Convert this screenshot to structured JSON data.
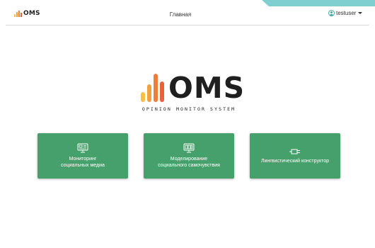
{
  "colors": {
    "accent_green": "#46a06b",
    "teal": "#7fcfd0",
    "logo_bars": [
      "#f6c048",
      "#f3a13f",
      "#ee7f3a",
      "#e9633a"
    ]
  },
  "header": {
    "logo_text": "OMS",
    "nav_home": "Главная",
    "username": "testuser",
    "user_icon": "user-circle-icon"
  },
  "hero": {
    "logo_text": "OMS",
    "tagline": "OPINION MONITOR SYSTEM"
  },
  "cards": [
    {
      "line1": "Мониторинг",
      "line2": "социальных медиа",
      "icon": "monitor-icon"
    },
    {
      "line1": "Моделирование",
      "line2": "социального самочувствия",
      "icon": "dashboard-icon"
    },
    {
      "line1": "Лингвистический конструктор",
      "line2": "",
      "icon": "plug-icon"
    }
  ]
}
